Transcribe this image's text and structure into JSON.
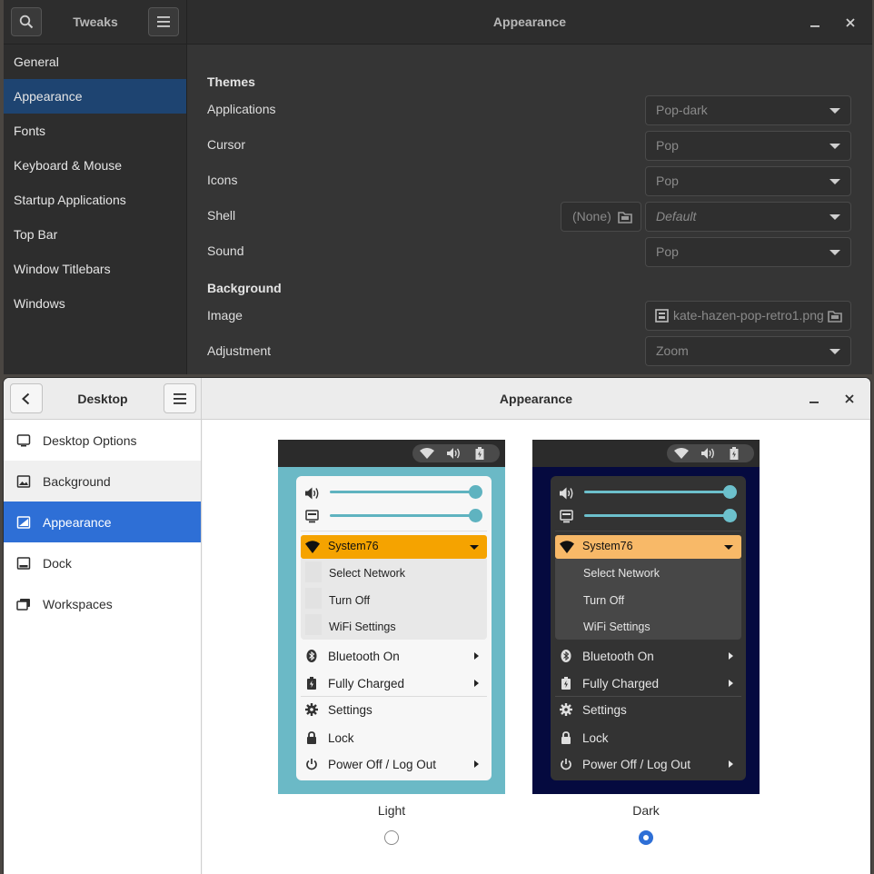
{
  "tweaks": {
    "app_title": "Tweaks",
    "page_title": "Appearance",
    "sidebar": [
      "General",
      "Appearance",
      "Fonts",
      "Keyboard & Mouse",
      "Startup Applications",
      "Top Bar",
      "Window Titlebars",
      "Windows"
    ],
    "selected": "Appearance",
    "themes": {
      "heading": "Themes",
      "applications_label": "Applications",
      "applications_value": "Pop-dark",
      "cursor_label": "Cursor",
      "cursor_value": "Pop",
      "icons_label": "Icons",
      "icons_value": "Pop",
      "shell_label": "Shell",
      "shell_file": "(None)",
      "shell_value": "Default",
      "sound_label": "Sound",
      "sound_value": "Pop"
    },
    "background": {
      "heading": "Background",
      "image_label": "Image",
      "image_value": "kate-hazen-pop-retro1.png",
      "adjustment_label": "Adjustment",
      "adjustment_value": "Zoom"
    }
  },
  "desktop": {
    "sidebar_title": "Desktop",
    "page_title": "Appearance",
    "sidebar": [
      {
        "label": "Desktop Options",
        "icon": "desktop-icon"
      },
      {
        "label": "Background",
        "icon": "image-icon"
      },
      {
        "label": "Appearance",
        "icon": "appearance-icon"
      },
      {
        "label": "Dock",
        "icon": "dock-icon"
      },
      {
        "label": "Workspaces",
        "icon": "workspaces-icon"
      }
    ],
    "selected": "Appearance",
    "preview_menu": {
      "network": "System76",
      "network_items": [
        "Select Network",
        "Turn Off",
        "WiFi Settings"
      ],
      "bluetooth": "Bluetooth On",
      "battery": "Fully Charged",
      "settings": "Settings",
      "lock": "Lock",
      "power": "Power Off / Log Out"
    },
    "options": [
      {
        "label": "Light",
        "selected": false
      },
      {
        "label": "Dark",
        "selected": true
      }
    ]
  },
  "colors": {
    "accent_blue": "#2e6fd6",
    "light_bg": "#6bb9c6",
    "dark_bg": "#050a3f",
    "network_orange_light": "#f5a300",
    "network_orange_dark": "#f8b968",
    "slider_teal": "#5fb3c0"
  }
}
